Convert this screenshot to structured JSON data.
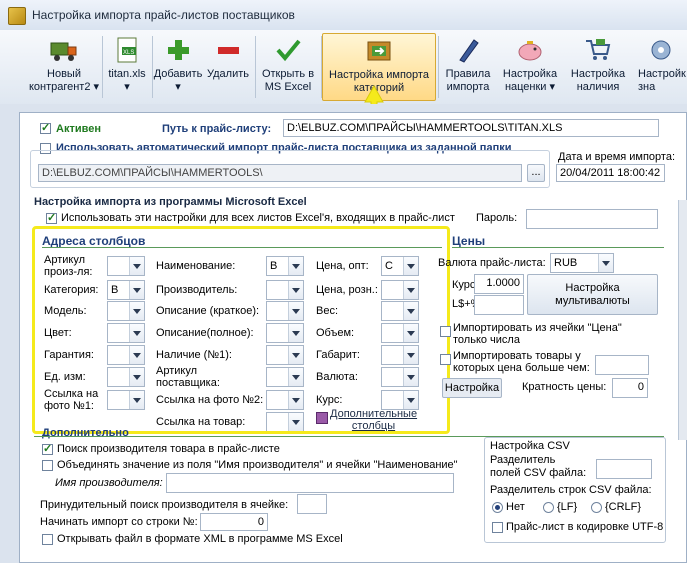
{
  "window": {
    "title": "Настройка импорта прайс-листов поставщиков"
  },
  "toolbar": {
    "buttons": [
      {
        "label": "Новый\nконтрагент2 ▾",
        "icon": "truck-icon"
      },
      {
        "label": "titan.xls\n▾",
        "icon": "xls-file-icon"
      },
      {
        "label": "Добавить\n▾",
        "icon": "plus-icon"
      },
      {
        "label": "Удалить",
        "icon": "minus-icon"
      },
      {
        "label": "Открыть в\nMS Excel",
        "icon": "checkmark-icon"
      },
      {
        "label": "Настройка импорта\nкатегорий",
        "icon": "categories-icon"
      },
      {
        "label": "Правила\nимпорта",
        "icon": "pen-icon"
      },
      {
        "label": "Настройка\nнаценки ▾",
        "icon": "piggy-bank-icon"
      },
      {
        "label": "Настройка\nналичия",
        "icon": "cart-icon"
      },
      {
        "label": "Настройк\nзна",
        "icon": "settings-icon"
      }
    ]
  },
  "form": {
    "active_label": "Активен",
    "path_label": "Путь к прайс-листу:",
    "path_value": "D:\\ELBUZ.COM\\ПРАЙСЫ\\HAMMERTOOLS\\TITAN.XLS",
    "auto_import_label": "Использовать автоматический импорт прайс-листа поставщика из заданной папки",
    "folder_value": "D:\\ELBUZ.COM\\ПРАЙСЫ\\HAMMERTOOLS\\",
    "folder_button": "...",
    "import_date_label": "Дата и время импорта:",
    "import_date_value": "20/04/2011 18:00:42"
  },
  "excel": {
    "title": "Настройка импорта из программы Microsoft Excel",
    "use_all_sheets": "Использовать эти настройки для всех листов Excel'я, входящих в прайс-лист",
    "password_label": "Пароль:"
  },
  "columns": {
    "title": "Адреса столбцов",
    "col1": [
      {
        "label": "Артикул\nпроиз-ля:",
        "value": ""
      },
      {
        "label": "Категория:",
        "value": "B"
      },
      {
        "label": "Модель:",
        "value": ""
      },
      {
        "label": "Цвет:",
        "value": ""
      },
      {
        "label": "Гарантия:",
        "value": ""
      },
      {
        "label": "Ед. изм:",
        "value": ""
      },
      {
        "label": "Ссылка на\nфото №1:",
        "value": ""
      }
    ],
    "col2": [
      {
        "label": "Наименование:",
        "value": "B"
      },
      {
        "label": "Производитель:",
        "value": ""
      },
      {
        "label": "Описание (краткое):",
        "value": ""
      },
      {
        "label": "Описание(полное):",
        "value": ""
      },
      {
        "label": "Наличие (№1):",
        "value": ""
      },
      {
        "label": "Артикул\nпоставщика:",
        "value": ""
      },
      {
        "label": "Ссылка на фото №2:",
        "value": ""
      },
      {
        "label": "Ссылка на товар:",
        "value": ""
      }
    ],
    "col3": [
      {
        "label": "Цена, опт:",
        "value": "C"
      },
      {
        "label": "Цена, розн.:",
        "value": ""
      },
      {
        "label": "Вес:",
        "value": ""
      },
      {
        "label": "Объем:",
        "value": ""
      },
      {
        "label": "Габарит:",
        "value": ""
      },
      {
        "label": "Валюта:",
        "value": ""
      },
      {
        "label": "Курс:",
        "value": ""
      }
    ],
    "extra_label": "Дополнительные\nстолбцы"
  },
  "prices": {
    "title": "Цены",
    "currency_label": "Валюта прайс-листа:",
    "currency_value": "RUB",
    "rate_label": "Курс:",
    "rate_value": "1.0000",
    "percent_label": "L$+%",
    "multi_currency_button": "Настройка\nмультивалюты",
    "import_price_numbers": "Импортировать из ячейки \"Цена\"\nтолько числа",
    "import_price_above": "Импортировать товары у\nкоторых цена больше чем:",
    "setting_button": "Настройка",
    "price_multiplicity_label": "Кратность цены:",
    "price_multiplicity_value": "0"
  },
  "additional": {
    "title": "Дополнительно",
    "search_manufacturer": "Поиск производителя товара в прайс-листе",
    "merge_fields": "Объединять значение из поля \"Имя производителя\" и ячейки \"Наименование\"",
    "manufacturer_name_label": "Имя производителя:",
    "forced_search_label": "Принудительный поиск производителя в ячейке:",
    "start_row_label": "Начинать импорт со строки №:",
    "start_row_value": "0",
    "open_xml": "Открывать файл в формате XML в программе MS Excel"
  },
  "csv": {
    "title": "Настройка CSV",
    "field_sep_label": "Разделитель\nполей CSV файла:",
    "row_sep_label": "Разделитель строк CSV файла:",
    "options": [
      "Нет",
      "{LF}",
      "{CRLF}"
    ],
    "utf8_label": "Прайс-лист в кодировке UTF-8"
  },
  "colors": {
    "highlight": "#f5ea1b",
    "accent": "#1f3f7a",
    "active_green": "#1f7a1f"
  }
}
